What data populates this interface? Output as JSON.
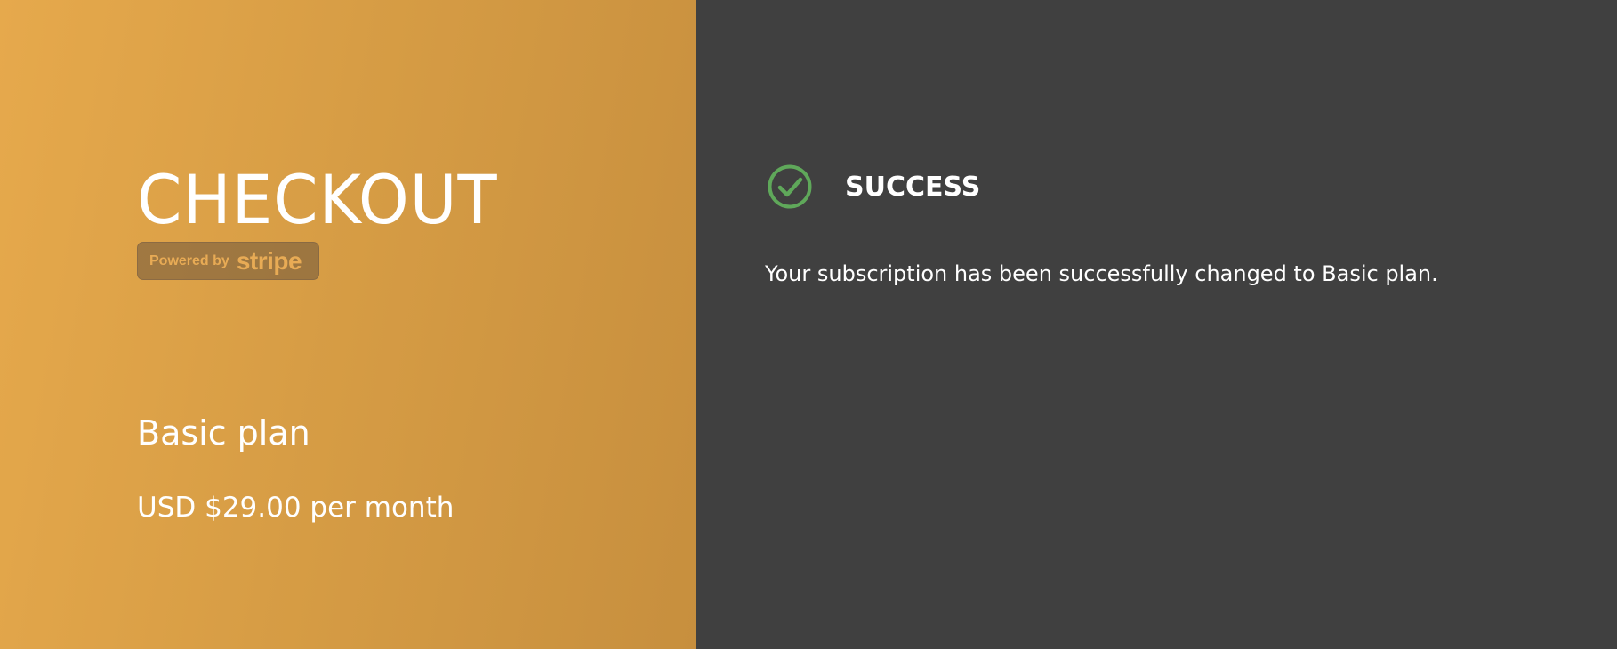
{
  "checkout": {
    "title": "CHECKOUT",
    "badge": {
      "powered_by": "Powered by",
      "brand": "stripe"
    },
    "plan": {
      "name": "Basic plan",
      "price": "USD $29.00 per month"
    }
  },
  "result": {
    "icon": "check-circle-icon",
    "status": "SUCCESS",
    "message": "Your subscription has been successfully changed to Basic plan."
  },
  "colors": {
    "left_gradient_start": "#e6a94c",
    "left_gradient_end": "#c78f3e",
    "right_background": "#404040",
    "success_green": "#5fa85a",
    "badge_text": "#e8ab55"
  }
}
